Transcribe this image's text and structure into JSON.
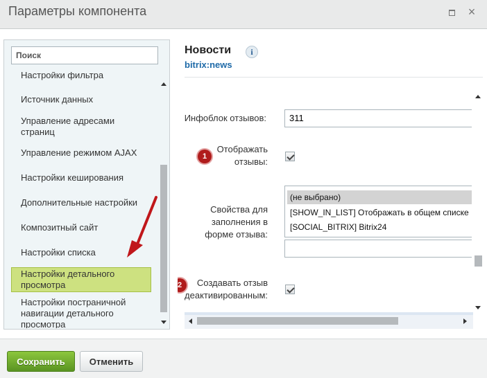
{
  "window": {
    "title": "Параметры компонента",
    "maximize_icon": "maximize-icon",
    "close_icon": "close-icon",
    "close_glyph": "×"
  },
  "sidebar": {
    "search_placeholder": "Поиск",
    "items": [
      {
        "label": "Настройки фильтра"
      },
      {
        "label": "Источник данных"
      },
      {
        "label": "Управление адресами страниц"
      },
      {
        "label": "Управление режимом AJAX"
      },
      {
        "label": "Настройки кеширования"
      },
      {
        "label": "Дополнительные настройки"
      },
      {
        "label": "Композитный сайт"
      },
      {
        "label": "Настройки списка"
      },
      {
        "label": "Настройки детального просмотра",
        "active": true
      },
      {
        "label": "Настройки постраничной навигации детального просмотра"
      }
    ]
  },
  "main": {
    "title": "Новости",
    "info_glyph": "i",
    "component_code": "bitrix:news",
    "fields": {
      "iblock_label": "Инфоблок отзывов:",
      "iblock_value": "311",
      "show_reviews_label": "Отображать отзывы:",
      "show_reviews_checked": true,
      "properties_label": "Свойства для заполнения в форме отзыва:",
      "properties_options": [
        {
          "label": "(не выбрано)",
          "selected": true
        },
        {
          "label": "[SHOW_IN_LIST] Отображать в общем списке",
          "selected": false
        },
        {
          "label": "[SOCIAL_BITRIX] Bitrix24",
          "selected": false
        }
      ],
      "properties_extra_value": "",
      "create_deactivated_label": "Создавать отзыв деактивированным:",
      "create_deactivated_checked": true
    },
    "badges": [
      "1",
      "2"
    ]
  },
  "annotation": {
    "arrow_color": "#c0171b"
  },
  "footer": {
    "save_label": "Сохранить",
    "cancel_label": "Отменить"
  },
  "colors": {
    "accent_green": "#6aa42a",
    "active_item_bg": "#cde180",
    "badge_red": "#b01c1c",
    "link_blue": "#1e6aa8"
  }
}
